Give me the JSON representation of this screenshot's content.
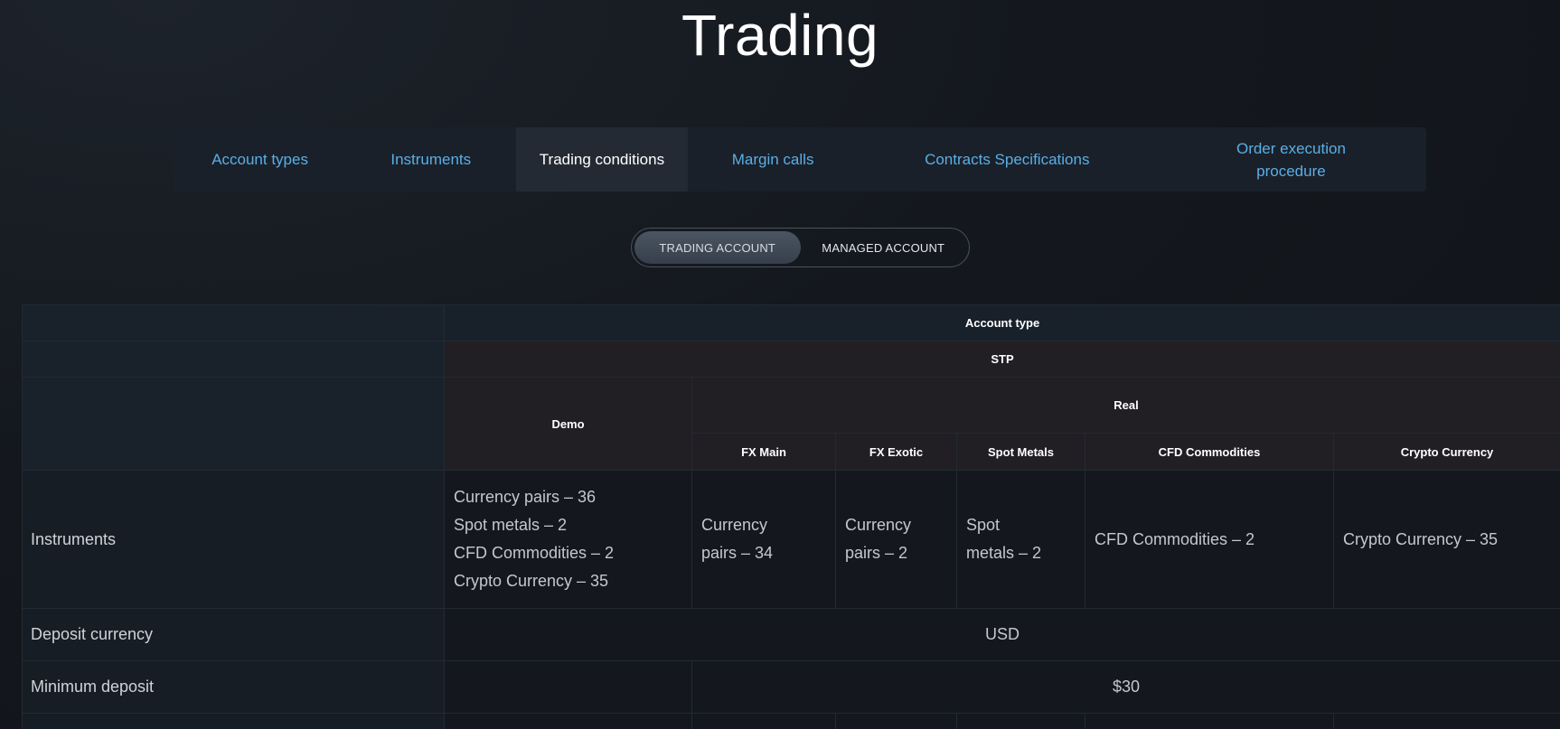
{
  "page": {
    "title": "Trading"
  },
  "tabs": [
    {
      "label": "Account types",
      "active": false
    },
    {
      "label": "Instruments",
      "active": false
    },
    {
      "label": "Trading conditions",
      "active": true
    },
    {
      "label": "Margin calls",
      "active": false
    },
    {
      "label": "Contracts Specifications",
      "active": false
    },
    {
      "label": "Order execution procedure",
      "active": false
    }
  ],
  "account_toggle": {
    "options": [
      {
        "label": "TRADING ACCOUNT",
        "active": true
      },
      {
        "label": "MANAGED ACCOUNT",
        "active": false
      }
    ]
  },
  "table": {
    "header": {
      "account_type": "Account type",
      "stp": "STP",
      "demo": "Demo",
      "real": "Real",
      "columns": [
        "FX Main",
        "FX Exotic",
        "Spot Metals",
        "CFD Commodities",
        "Crypto Currency"
      ]
    },
    "rows": {
      "instruments": {
        "label": "Instruments",
        "demo": [
          "Currency pairs – 36",
          "Spot metals – 2",
          "CFD Commodities – 2",
          "Crypto Currency – 35"
        ],
        "fx_main": [
          "Currency",
          "pairs – 34"
        ],
        "fx_exotic": [
          "Currency",
          "pairs – 2"
        ],
        "spot_metals": [
          "Spot",
          "metals – 2"
        ],
        "cfd_commodities": "CFD Commodities – 2",
        "crypto_currency": "Crypto Currency – 35"
      },
      "deposit_currency": {
        "label": "Deposit currency",
        "value": "USD"
      },
      "minimum_deposit": {
        "label": "Minimum deposit",
        "demo": "",
        "value": "$30"
      }
    }
  },
  "colors": {
    "background": "#14181e",
    "tab_link": "#5aaee6",
    "tab_active_bg": "#232a34",
    "header_warm": "#211f24"
  }
}
